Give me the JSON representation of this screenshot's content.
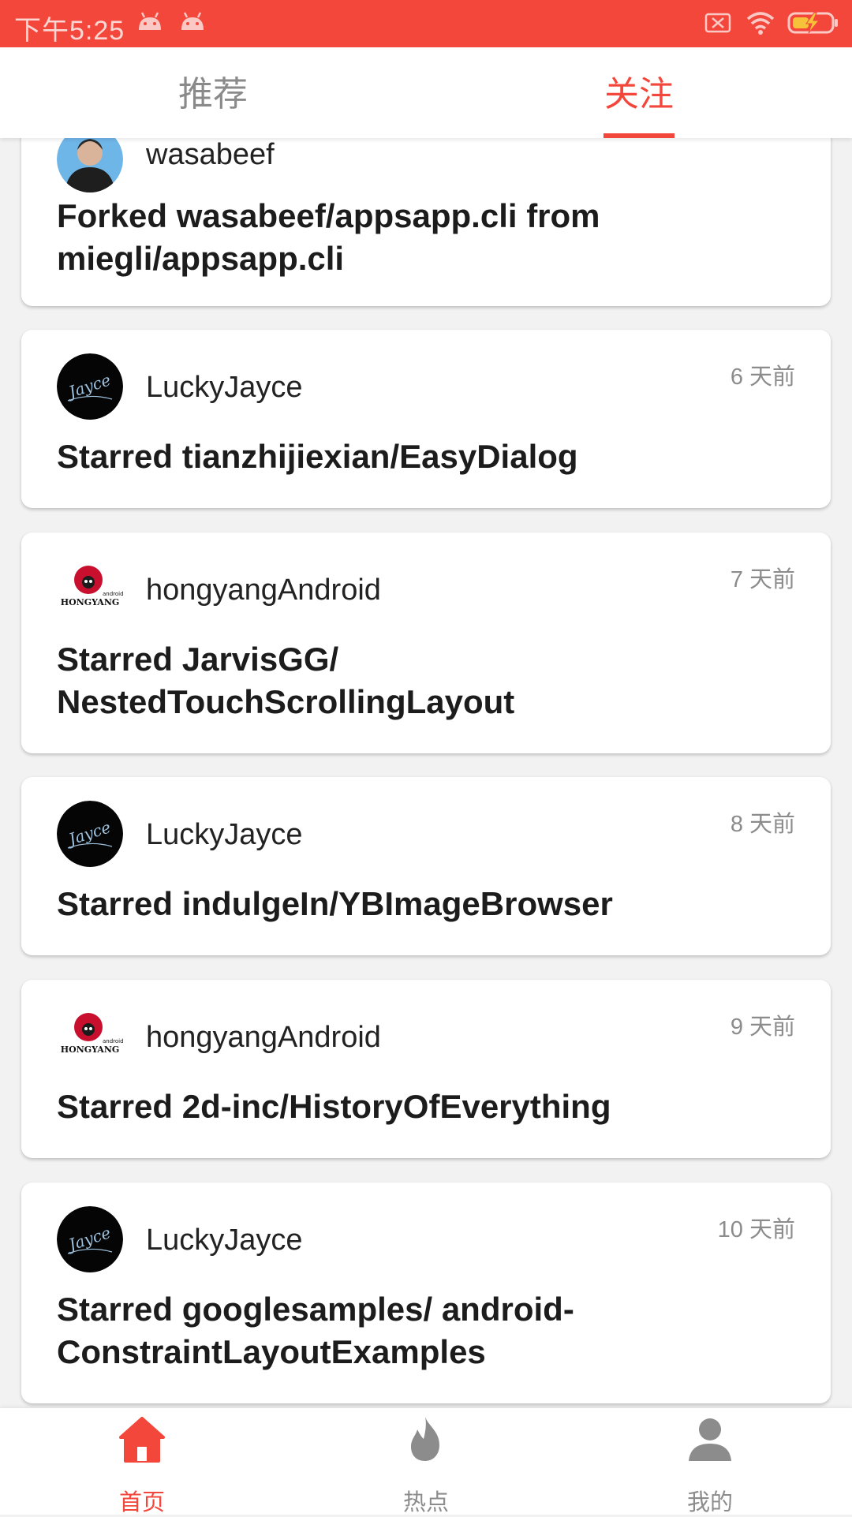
{
  "status_bar": {
    "time": "下午5:25"
  },
  "top_tabs": [
    {
      "label": "推荐",
      "active": false
    },
    {
      "label": "关注",
      "active": true
    }
  ],
  "feed": [
    {
      "user": "wasabeef",
      "time_ago": "",
      "event": "Forked wasabeef/appsapp.cli from miegli/appsapp.cli",
      "avatar": "person-avatar"
    },
    {
      "user": "LuckyJayce",
      "time_ago": "6 天前",
      "event": "Starred tianzhijiexian/EasyDialog",
      "avatar": "jayce-signature-avatar"
    },
    {
      "user": "hongyangAndroid",
      "time_ago": "7 天前",
      "event": "Starred JarvisGG/ NestedTouchScrollingLayout",
      "avatar": "hongyang-sheep-avatar"
    },
    {
      "user": "LuckyJayce",
      "time_ago": "8 天前",
      "event": "Starred indulgeIn/YBImageBrowser",
      "avatar": "jayce-signature-avatar"
    },
    {
      "user": "hongyangAndroid",
      "time_ago": "9 天前",
      "event": "Starred 2d-inc/HistoryOfEverything",
      "avatar": "hongyang-sheep-avatar"
    },
    {
      "user": "LuckyJayce",
      "time_ago": "10 天前",
      "event": "Starred googlesamples/ android-ConstraintLayoutExamples",
      "avatar": "jayce-signature-avatar"
    }
  ],
  "bottom_nav": [
    {
      "label": "首页",
      "icon": "home-icon",
      "active": true
    },
    {
      "label": "热点",
      "icon": "flame-icon",
      "active": false
    },
    {
      "label": "我的",
      "icon": "person-icon",
      "active": false
    }
  ],
  "colors": {
    "accent": "#f4473c",
    "inactive": "#8c8c8c",
    "background": "#f2f2f2"
  },
  "avatar_text": {
    "hongyang_small": "android",
    "hongyang_brand": "HONGYANG",
    "jayce_signature": "Jayce"
  }
}
